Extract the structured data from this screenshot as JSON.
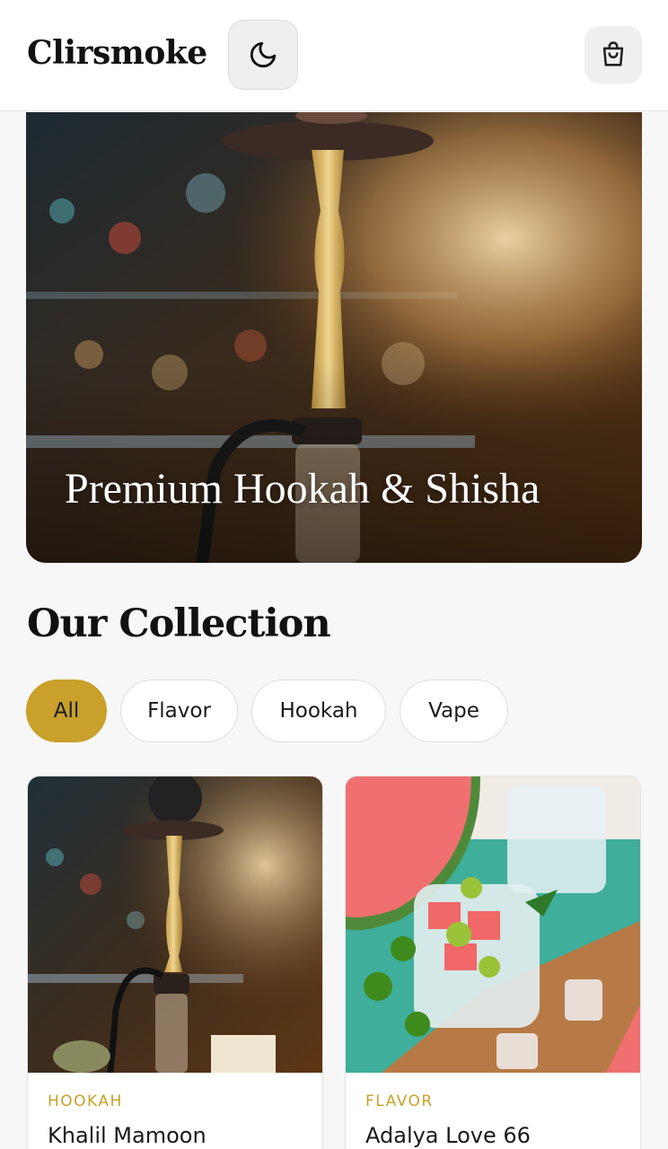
{
  "header": {
    "brand": "Clirsmoke",
    "theme_toggle_icon": "moon-icon",
    "cart_icon": "shopping-bag-icon"
  },
  "hero": {
    "title": "Premium Hookah & Shisha"
  },
  "collection": {
    "title": "Our Collection",
    "filters": [
      {
        "label": "All",
        "active": true
      },
      {
        "label": "Flavor",
        "active": false
      },
      {
        "label": "Hookah",
        "active": false
      },
      {
        "label": "Vape",
        "active": false
      }
    ]
  },
  "products": [
    {
      "category": "HOOKAH",
      "name": "Khalil Mamoon"
    },
    {
      "category": "FLAVOR",
      "name": "Adalya Love 66"
    }
  ],
  "colors": {
    "accent": "#c8a02a",
    "background": "#f8f7f7",
    "text": "#111111"
  }
}
